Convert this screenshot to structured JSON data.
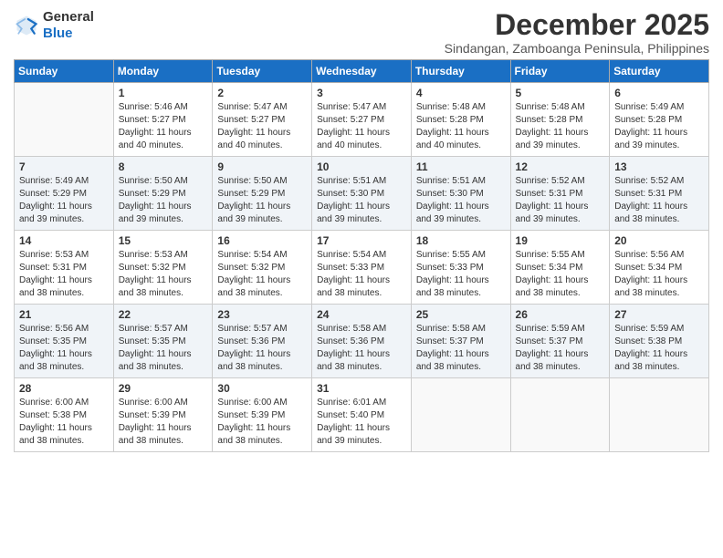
{
  "header": {
    "logo_general": "General",
    "logo_blue": "Blue",
    "month_year": "December 2025",
    "location": "Sindangan, Zamboanga Peninsula, Philippines"
  },
  "days_of_week": [
    "Sunday",
    "Monday",
    "Tuesday",
    "Wednesday",
    "Thursday",
    "Friday",
    "Saturday"
  ],
  "weeks": [
    [
      {
        "day": "",
        "info": ""
      },
      {
        "day": "1",
        "info": "Sunrise: 5:46 AM\nSunset: 5:27 PM\nDaylight: 11 hours\nand 40 minutes."
      },
      {
        "day": "2",
        "info": "Sunrise: 5:47 AM\nSunset: 5:27 PM\nDaylight: 11 hours\nand 40 minutes."
      },
      {
        "day": "3",
        "info": "Sunrise: 5:47 AM\nSunset: 5:27 PM\nDaylight: 11 hours\nand 40 minutes."
      },
      {
        "day": "4",
        "info": "Sunrise: 5:48 AM\nSunset: 5:28 PM\nDaylight: 11 hours\nand 40 minutes."
      },
      {
        "day": "5",
        "info": "Sunrise: 5:48 AM\nSunset: 5:28 PM\nDaylight: 11 hours\nand 39 minutes."
      },
      {
        "day": "6",
        "info": "Sunrise: 5:49 AM\nSunset: 5:28 PM\nDaylight: 11 hours\nand 39 minutes."
      }
    ],
    [
      {
        "day": "7",
        "info": "Sunrise: 5:49 AM\nSunset: 5:29 PM\nDaylight: 11 hours\nand 39 minutes."
      },
      {
        "day": "8",
        "info": "Sunrise: 5:50 AM\nSunset: 5:29 PM\nDaylight: 11 hours\nand 39 minutes."
      },
      {
        "day": "9",
        "info": "Sunrise: 5:50 AM\nSunset: 5:29 PM\nDaylight: 11 hours\nand 39 minutes."
      },
      {
        "day": "10",
        "info": "Sunrise: 5:51 AM\nSunset: 5:30 PM\nDaylight: 11 hours\nand 39 minutes."
      },
      {
        "day": "11",
        "info": "Sunrise: 5:51 AM\nSunset: 5:30 PM\nDaylight: 11 hours\nand 39 minutes."
      },
      {
        "day": "12",
        "info": "Sunrise: 5:52 AM\nSunset: 5:31 PM\nDaylight: 11 hours\nand 39 minutes."
      },
      {
        "day": "13",
        "info": "Sunrise: 5:52 AM\nSunset: 5:31 PM\nDaylight: 11 hours\nand 38 minutes."
      }
    ],
    [
      {
        "day": "14",
        "info": "Sunrise: 5:53 AM\nSunset: 5:31 PM\nDaylight: 11 hours\nand 38 minutes."
      },
      {
        "day": "15",
        "info": "Sunrise: 5:53 AM\nSunset: 5:32 PM\nDaylight: 11 hours\nand 38 minutes."
      },
      {
        "day": "16",
        "info": "Sunrise: 5:54 AM\nSunset: 5:32 PM\nDaylight: 11 hours\nand 38 minutes."
      },
      {
        "day": "17",
        "info": "Sunrise: 5:54 AM\nSunset: 5:33 PM\nDaylight: 11 hours\nand 38 minutes."
      },
      {
        "day": "18",
        "info": "Sunrise: 5:55 AM\nSunset: 5:33 PM\nDaylight: 11 hours\nand 38 minutes."
      },
      {
        "day": "19",
        "info": "Sunrise: 5:55 AM\nSunset: 5:34 PM\nDaylight: 11 hours\nand 38 minutes."
      },
      {
        "day": "20",
        "info": "Sunrise: 5:56 AM\nSunset: 5:34 PM\nDaylight: 11 hours\nand 38 minutes."
      }
    ],
    [
      {
        "day": "21",
        "info": "Sunrise: 5:56 AM\nSunset: 5:35 PM\nDaylight: 11 hours\nand 38 minutes."
      },
      {
        "day": "22",
        "info": "Sunrise: 5:57 AM\nSunset: 5:35 PM\nDaylight: 11 hours\nand 38 minutes."
      },
      {
        "day": "23",
        "info": "Sunrise: 5:57 AM\nSunset: 5:36 PM\nDaylight: 11 hours\nand 38 minutes."
      },
      {
        "day": "24",
        "info": "Sunrise: 5:58 AM\nSunset: 5:36 PM\nDaylight: 11 hours\nand 38 minutes."
      },
      {
        "day": "25",
        "info": "Sunrise: 5:58 AM\nSunset: 5:37 PM\nDaylight: 11 hours\nand 38 minutes."
      },
      {
        "day": "26",
        "info": "Sunrise: 5:59 AM\nSunset: 5:37 PM\nDaylight: 11 hours\nand 38 minutes."
      },
      {
        "day": "27",
        "info": "Sunrise: 5:59 AM\nSunset: 5:38 PM\nDaylight: 11 hours\nand 38 minutes."
      }
    ],
    [
      {
        "day": "28",
        "info": "Sunrise: 6:00 AM\nSunset: 5:38 PM\nDaylight: 11 hours\nand 38 minutes."
      },
      {
        "day": "29",
        "info": "Sunrise: 6:00 AM\nSunset: 5:39 PM\nDaylight: 11 hours\nand 38 minutes."
      },
      {
        "day": "30",
        "info": "Sunrise: 6:00 AM\nSunset: 5:39 PM\nDaylight: 11 hours\nand 38 minutes."
      },
      {
        "day": "31",
        "info": "Sunrise: 6:01 AM\nSunset: 5:40 PM\nDaylight: 11 hours\nand 39 minutes."
      },
      {
        "day": "",
        "info": ""
      },
      {
        "day": "",
        "info": ""
      },
      {
        "day": "",
        "info": ""
      }
    ]
  ]
}
